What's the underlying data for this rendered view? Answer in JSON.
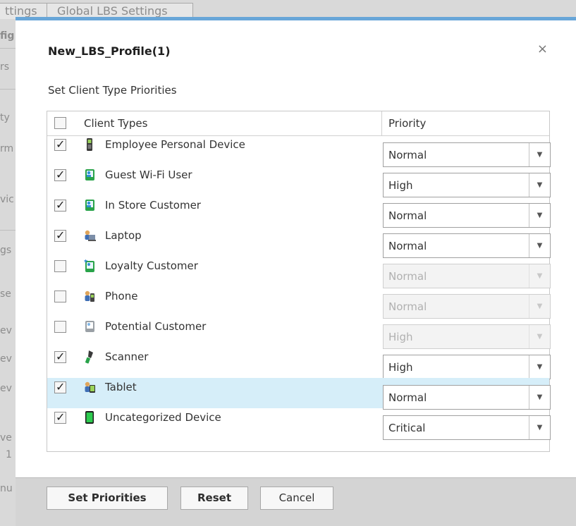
{
  "background": {
    "tabs": [
      "ttings",
      "Global LBS Settings"
    ],
    "side_fragments": [
      "fig",
      "rs",
      "ty",
      "rm",
      "vic",
      "gs",
      "se",
      "ev",
      "ev",
      "ev",
      "ve",
      "1",
      "nu"
    ]
  },
  "dialog": {
    "title": "New_LBS_Profile(1)",
    "close_glyph": "×",
    "subtitle": "Set Client Type Priorities",
    "accent_color": "#68a6d8"
  },
  "table": {
    "header": {
      "client_types": "Client Types",
      "priority": "Priority"
    },
    "rows": [
      {
        "label": "Employee Personal Device",
        "icon": "mobile-phone-icon",
        "checked": true,
        "priority": "Normal"
      },
      {
        "label": "Guest Wi-Fi User",
        "icon": "user-card-icon",
        "checked": true,
        "priority": "High"
      },
      {
        "label": "In Store Customer",
        "icon": "user-card-icon",
        "checked": true,
        "priority": "Normal"
      },
      {
        "label": "Laptop",
        "icon": "laptop-user-icon",
        "checked": true,
        "priority": "Normal"
      },
      {
        "label": "Loyalty Customer",
        "icon": "loyalty-customer-icon",
        "checked": false,
        "priority": "Normal"
      },
      {
        "label": "Phone",
        "icon": "phone-user-icon",
        "checked": false,
        "priority": "Normal"
      },
      {
        "label": "Potential Customer",
        "icon": "potential-customer-icon",
        "checked": false,
        "priority": "High"
      },
      {
        "label": "Scanner",
        "icon": "scanner-icon",
        "checked": true,
        "priority": "High"
      },
      {
        "label": "Tablet",
        "icon": "tablet-user-icon",
        "checked": true,
        "priority": "Normal"
      },
      {
        "label": "Uncategorized Device",
        "icon": "uncategorized-device-icon",
        "checked": true,
        "priority": "Critical"
      }
    ],
    "selected_row": "Tablet"
  },
  "footer": {
    "set_priorities": "Set Priorities",
    "reset": "Reset",
    "cancel": "Cancel"
  }
}
